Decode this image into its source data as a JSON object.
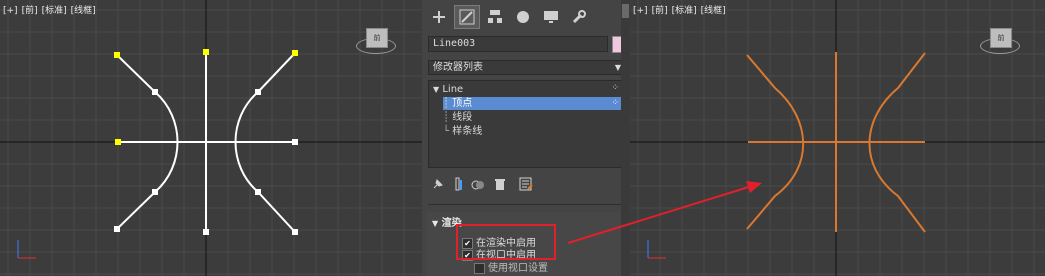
{
  "left_viewport": {
    "labels": [
      "[+]",
      "[前]",
      "[标准]",
      "[线框]"
    ],
    "viewcube_label": "前"
  },
  "right_viewport": {
    "labels": [
      "[+]",
      "[前]",
      "[标准]",
      "[线框]"
    ],
    "viewcube_label": "前"
  },
  "panel": {
    "tabs": [
      {
        "icon": "plus-icon",
        "glyph": "+"
      },
      {
        "icon": "modify-icon",
        "glyph": "◩"
      },
      {
        "icon": "hierarchy-icon",
        "glyph": "⊤"
      },
      {
        "icon": "motion-icon",
        "glyph": "●"
      },
      {
        "icon": "display-icon",
        "glyph": "▬"
      },
      {
        "icon": "utilities-icon",
        "glyph": "🔧"
      }
    ],
    "object_name": "Line003",
    "object_color": "#f0c8e0",
    "modifier_list_label": "修改器列表",
    "stack": {
      "root": "Line",
      "items": [
        "顶点",
        "线段",
        "样条线"
      ],
      "selected": "顶点"
    },
    "rollout_title": "渲染",
    "checkboxes": [
      {
        "label": "在渲染中启用",
        "checked": true
      },
      {
        "label": "在视口中启用",
        "checked": true
      },
      {
        "label": "使用视口设置",
        "checked": false
      }
    ]
  },
  "annotation_color": "#e0202a",
  "spline_color_right": "#d9782f"
}
